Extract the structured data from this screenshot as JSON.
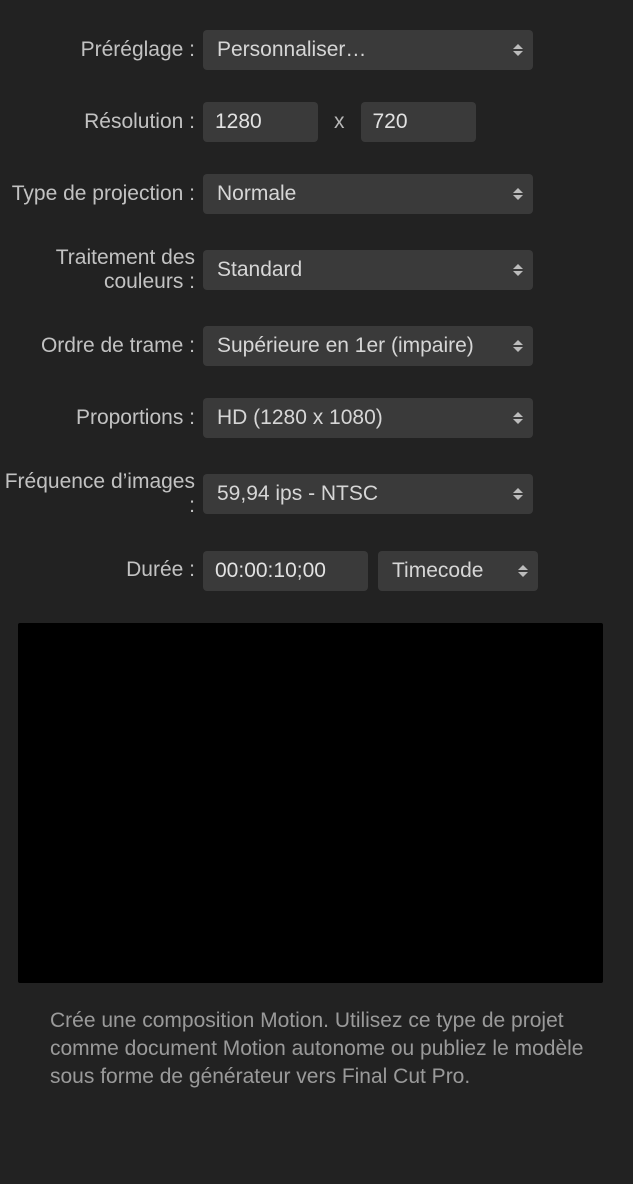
{
  "labels": {
    "preset": "Préréglage :",
    "resolution": "Résolution :",
    "projection": "Type de projection :",
    "color": "Traitement des couleurs :",
    "fieldorder": "Ordre de trame :",
    "aspect": "Proportions :",
    "framerate": "Fréquence d’images :",
    "duration": "Durée :"
  },
  "values": {
    "preset": "Personnaliser…",
    "res_w": "1280",
    "res_sep": "x",
    "res_h": "720",
    "projection": "Normale",
    "color": "Standard",
    "fieldorder": "Supérieure en 1er (impaire)",
    "aspect": "HD (1280 x 1080)",
    "framerate": "59,94 ips - NTSC",
    "duration_tc": "00:00:10;00",
    "duration_mode": "Timecode"
  },
  "description": "Crée une composition Motion. Utilisez ce type de projet comme document Motion autonome ou publiez le modèle sous forme de générateur vers Final Cut Pro."
}
